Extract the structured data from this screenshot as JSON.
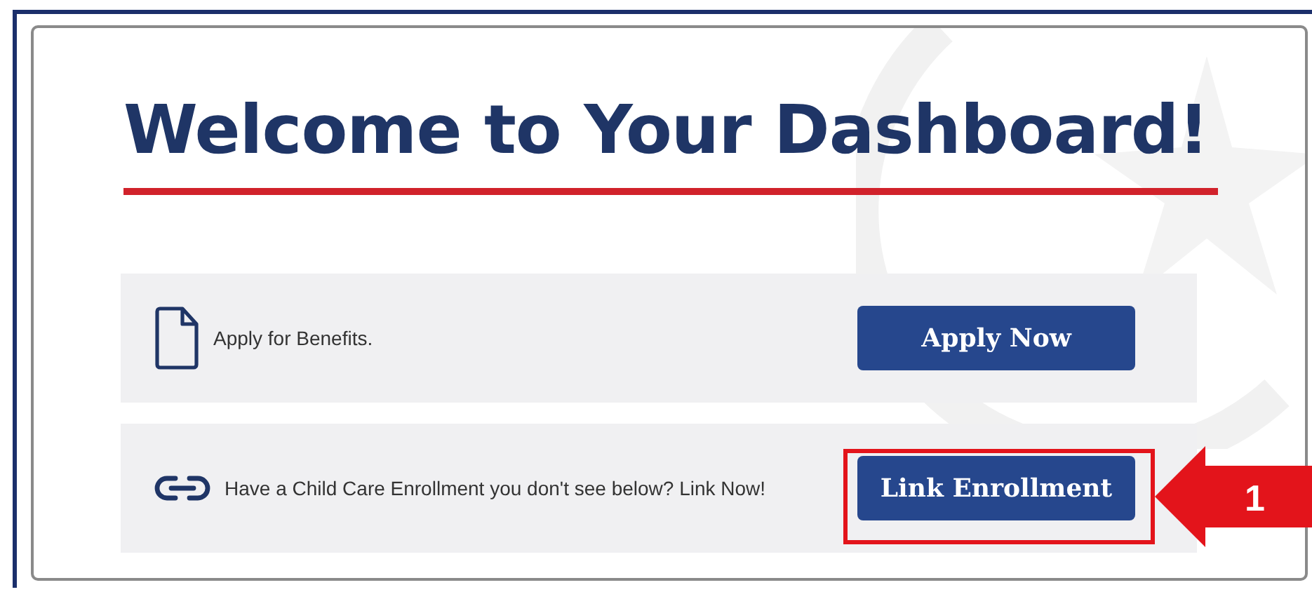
{
  "title": "Welcome to Your Dashboard!",
  "rows": [
    {
      "kind": "document",
      "text": "Apply for Benefits.",
      "button": "Apply Now",
      "highlighted": false
    },
    {
      "kind": "link",
      "text": "Have a Child Care Enrollment you don't see below? Link Now!",
      "button": "Link Enrollment",
      "highlighted": true
    }
  ],
  "callout": {
    "number": "1"
  }
}
